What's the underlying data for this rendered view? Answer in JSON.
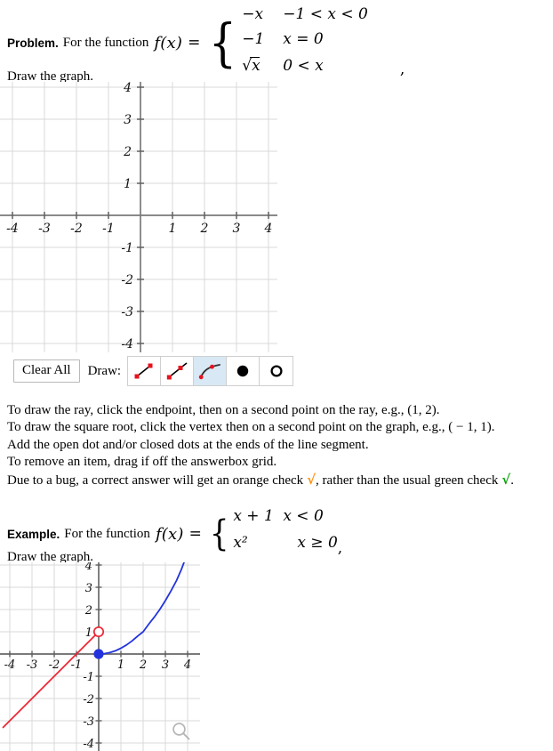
{
  "problem": {
    "label": "Problem.",
    "lead": "For the function",
    "fx": "f(x)",
    "equals": "=",
    "trailing_comma": ",",
    "pieces": [
      {
        "expr": "−x",
        "cond": "−1 < x < 0"
      },
      {
        "expr": "−1",
        "cond": "x = 0"
      },
      {
        "expr": "√x",
        "cond": "0 < x"
      }
    ],
    "draw_label": "Draw the graph."
  },
  "answer_grid": {
    "x_ticks": [
      "-4",
      "-3",
      "-2",
      "-1",
      "1",
      "2",
      "3",
      "4"
    ],
    "y_ticks": [
      "4",
      "3",
      "2",
      "1",
      "-1",
      "-2",
      "-3",
      "-4"
    ],
    "xlim": [
      -4.3,
      4.15
    ],
    "ylim": [
      -4.15,
      4.15
    ],
    "grid_color": "#d4d4d4",
    "axis_color": "#7a7a7a",
    "curves": []
  },
  "toolbar": {
    "clear_label": "Clear All",
    "draw_label": "Draw:",
    "tools": [
      {
        "name": "segment-tool",
        "icon": "line-segment-icon",
        "selected": false
      },
      {
        "name": "ray-tool",
        "icon": "ray-icon",
        "selected": false
      },
      {
        "name": "square-root-tool",
        "icon": "square-root-curve-icon",
        "selected": true
      },
      {
        "name": "closed-dot-tool",
        "icon": "closed-dot-icon",
        "selected": false
      },
      {
        "name": "open-dot-tool",
        "icon": "open-dot-icon",
        "selected": false
      }
    ]
  },
  "instructions": {
    "line1": "To draw the ray, click the endpoint, then on a second point on the ray, e.g., (1, 2).",
    "line2": "To draw the square root, click the vertex then on a second point on the graph, e.g., ( − 1, 1).",
    "line3": "Add the open dot and/or closed dots at the ends of the line segment.",
    "line4": "To remove an item, drag if off the answerbox grid.",
    "line5_a": "Due to a bug, a correct answer will get an orange check",
    "line5_check_orange": "√",
    "line5_b": ", rather than the usual green check",
    "line5_check_green": "√",
    "line5_c": ".",
    "orange_color": "#ff8c00",
    "green_color": "#00a000"
  },
  "example": {
    "label": "Example.",
    "lead": "For the function",
    "fx": "f(x)",
    "equals": "=",
    "trailing_comma": ",",
    "pieces": [
      {
        "expr": "x + 1",
        "cond": "x < 0"
      },
      {
        "expr": "x²",
        "cond": "x ≥ 0"
      }
    ],
    "draw_label": "Draw the graph."
  },
  "example_grid": {
    "x_ticks": [
      "-4",
      "-3",
      "-2",
      "-1",
      "1",
      "2",
      "3",
      "4"
    ],
    "y_ticks": [
      "4",
      "3",
      "2",
      "1",
      "-1",
      "-2",
      "-3",
      "-4"
    ],
    "grid_color": "#d4d4d4",
    "axis_color": "#7a7a7a",
    "magnifier_icon": "magnifier-icon"
  },
  "chart_data": [
    {
      "id": "answer-grid",
      "type": "line",
      "title": "",
      "xlabel": "",
      "ylabel": "",
      "xlim": [
        -4.3,
        4.2
      ],
      "ylim": [
        -4.2,
        4.2
      ],
      "xticks": [
        -4,
        -3,
        -2,
        -1,
        1,
        2,
        3,
        4
      ],
      "yticks": [
        4,
        3,
        2,
        1,
        -1,
        -2,
        -3,
        -4
      ],
      "grid": true,
      "legend": "none",
      "series": []
    },
    {
      "id": "example-grid",
      "type": "line",
      "title": "",
      "xlabel": "",
      "ylabel": "",
      "xlim": [
        -4.4,
        4.2
      ],
      "ylim": [
        -4.3,
        4.3
      ],
      "xticks": [
        -4,
        -3,
        -2,
        -1,
        1,
        2,
        3,
        4
      ],
      "yticks": [
        4,
        3,
        2,
        1,
        -1,
        -2,
        -3,
        -4
      ],
      "grid": true,
      "legend": "none",
      "series": [
        {
          "name": "x + 1 (x < 0)",
          "color": "#ee2233",
          "type": "ray",
          "points": [
            [
              -4.0,
              -3.0
            ],
            [
              0,
              1
            ]
          ],
          "endpoint_marker": "open-circle",
          "endpoint": [
            0,
            1
          ]
        },
        {
          "name": "x² (x ≥ 0)",
          "color": "#2233dd",
          "type": "parabola",
          "points": [
            [
              0,
              0
            ],
            [
              0.5,
              0.25
            ],
            [
              1,
              1
            ],
            [
              1.5,
              2.25
            ],
            [
              2,
              4
            ]
          ],
          "endpoint_marker": "closed-circle",
          "endpoint": [
            0,
            0
          ]
        }
      ]
    }
  ]
}
